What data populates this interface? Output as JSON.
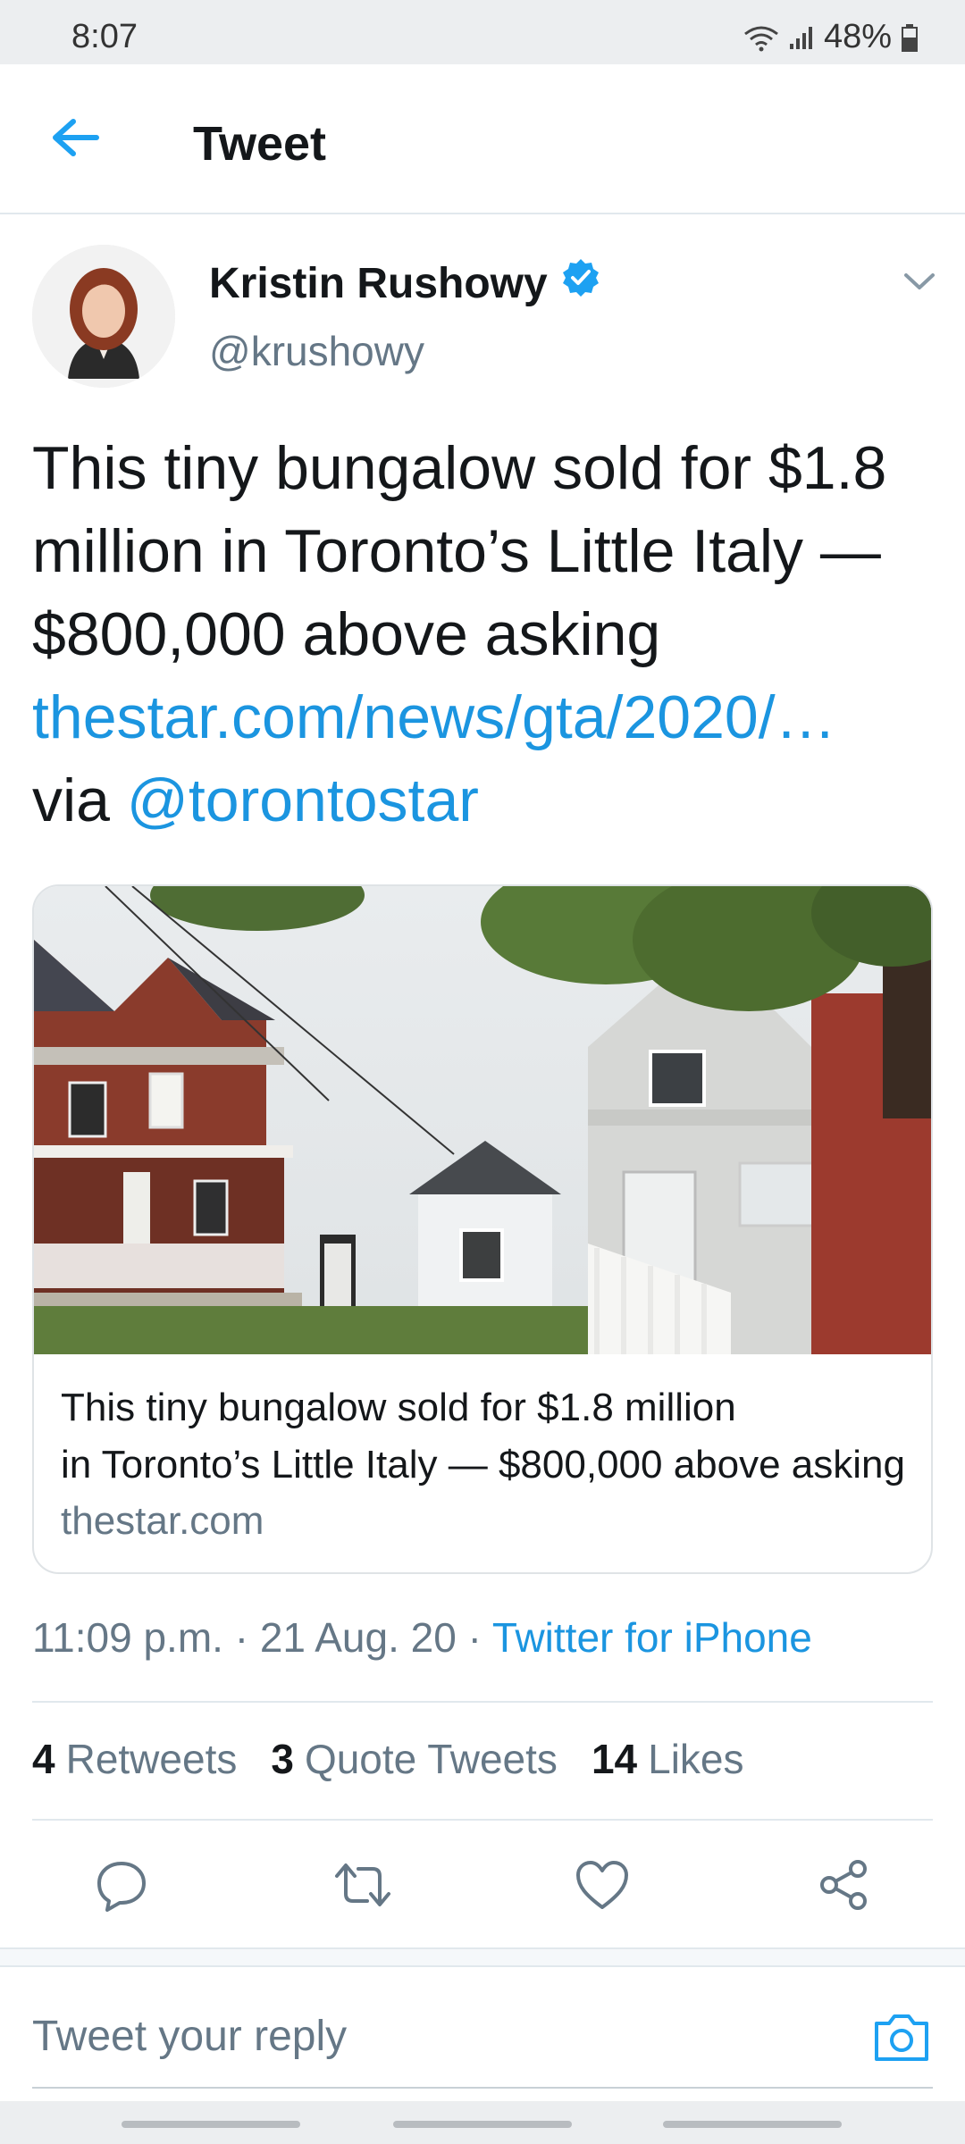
{
  "status_bar": {
    "time": "8:07",
    "battery": "48%"
  },
  "header": {
    "title": "Tweet",
    "back_icon": "arrow-left-icon"
  },
  "author": {
    "name": "Kristin Rushowy",
    "handle": "@krushowy",
    "verified": true
  },
  "tweet": {
    "text": "This tiny bungalow sold for $1.8 million in Toronto’s Little Italy — $800,000 above asking",
    "link": "thestar.com/news/gta/2020/…",
    "via_prefix": "via ",
    "mention": "@torontostar"
  },
  "card": {
    "title_line1": "This tiny bungalow sold for $1.8 million",
    "title_line2": "in Toronto’s Little Italy — $800,000 above asking",
    "domain": "thestar.com"
  },
  "meta": {
    "time": "11:09 p.m.",
    "date": "21 Aug. 20",
    "separator": " · ",
    "source": "Twitter for iPhone"
  },
  "stats": {
    "retweets_count": "4",
    "retweets_label": "Retweets",
    "quotes_count": "3",
    "quotes_label": "Quote Tweets",
    "likes_count": "14",
    "likes_label": "Likes"
  },
  "actions": [
    "reply-icon",
    "retweet-icon",
    "like-icon",
    "share-icon"
  ],
  "reply": {
    "placeholder": "Tweet your reply",
    "camera_icon": "camera-icon"
  },
  "colors": {
    "link": "#1b95e0",
    "secondary_text": "#657786",
    "primary_text": "#14171a"
  }
}
